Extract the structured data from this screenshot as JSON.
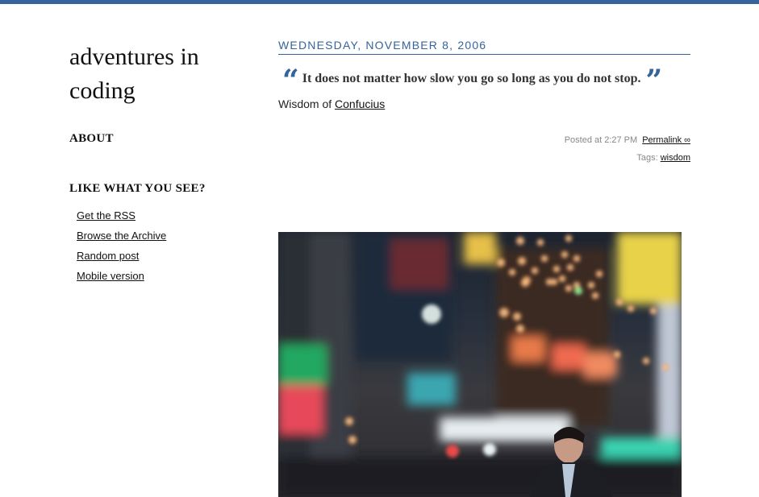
{
  "blog": {
    "title": "adventures in coding"
  },
  "sidebar": {
    "about_label": "ABOUT",
    "like_heading": "LIKE WHAT YOU SEE?",
    "links": [
      "Get the RSS",
      "Browse the Archive",
      "Random post",
      "Mobile version"
    ]
  },
  "post": {
    "date": "WEDNESDAY, NOVEMBER 8, 2006",
    "quote": "It does not matter how slow you go so long as you do not stop.",
    "wisdom_prefix": "Wisdom of ",
    "author": "Confucius",
    "posted_at": "Posted at 2:27 PM",
    "permalink": "Permalink ∞",
    "tags_label": "Tags: ",
    "tag": "wisdom"
  },
  "colors": {
    "accent": "#36649a"
  },
  "icons": {
    "open_quote": "open-quote-icon",
    "close_quote": "close-quote-icon"
  },
  "image": {
    "subject": "blurred city street at night with bokeh lights"
  }
}
